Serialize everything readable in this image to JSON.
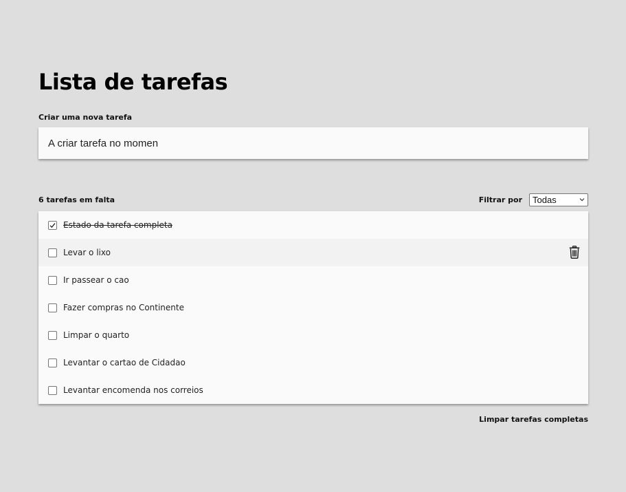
{
  "header": {
    "title": "Lista de tarefas"
  },
  "new_task": {
    "label": "Criar uma nova tarefa",
    "value": "A criar tarefa no momen"
  },
  "summary": {
    "remaining": "6 tarefas em falta"
  },
  "filter": {
    "label": "Filtrar por",
    "selected": "Todas"
  },
  "tasks": [
    {
      "label": "Estado da tarefa completa",
      "completed": true
    },
    {
      "label": "Levar o lixo",
      "completed": false
    },
    {
      "label": "Ir passear o cao",
      "completed": false
    },
    {
      "label": "Fazer compras no Continente",
      "completed": false
    },
    {
      "label": "Limpar o quarto",
      "completed": false
    },
    {
      "label": "Levantar o cartao de Cidadao",
      "completed": false
    },
    {
      "label": "Levantar encomenda nos correios",
      "completed": false
    }
  ],
  "icons": {
    "delete": "trash-icon",
    "check": "check-icon",
    "select": "chevron-down-icon"
  },
  "footer": {
    "clear_label": "Limpar tarefas completas"
  }
}
